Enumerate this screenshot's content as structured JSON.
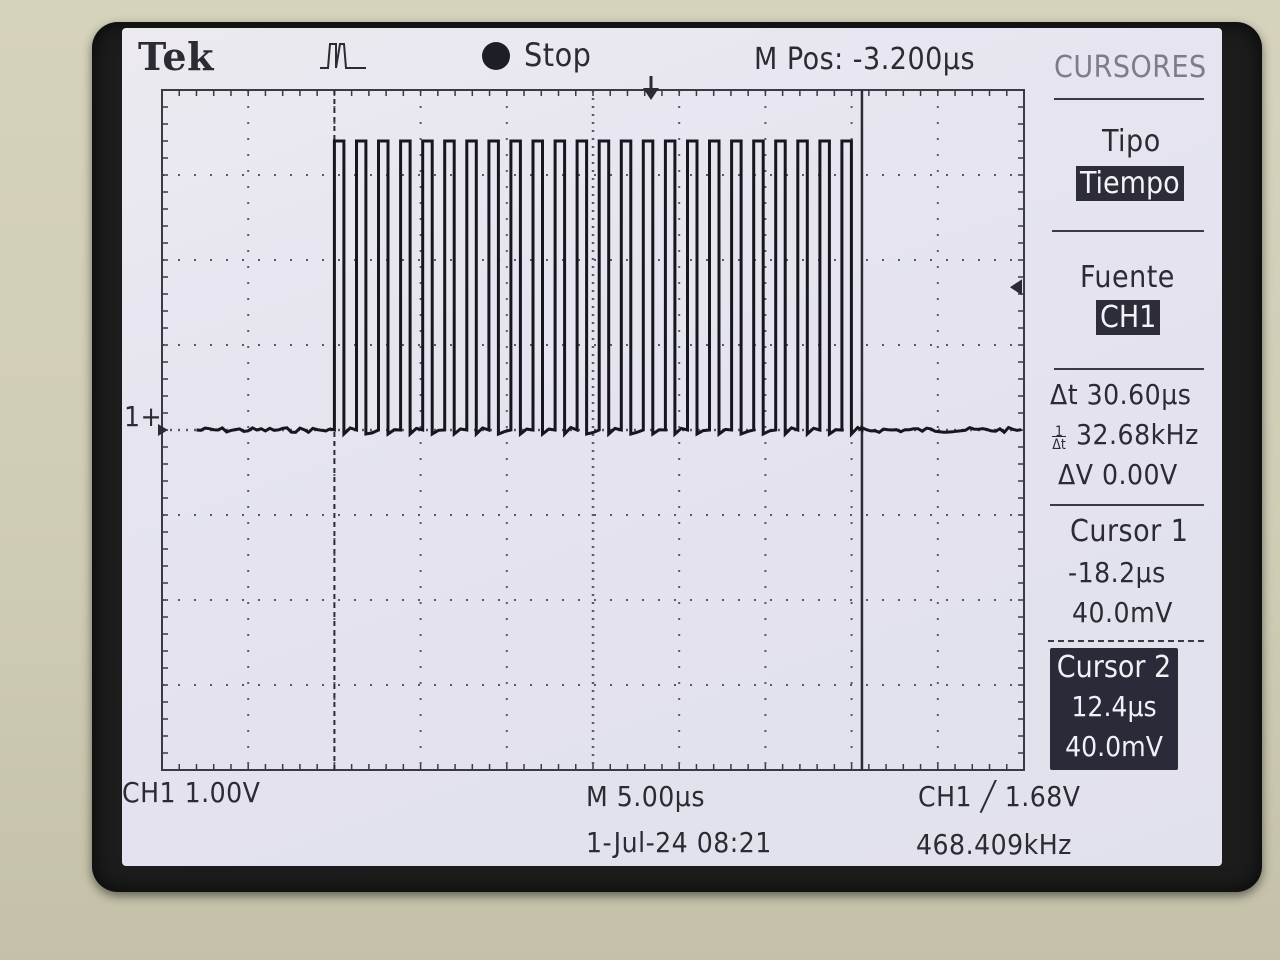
{
  "header": {
    "brand": "Tek",
    "trigger_state": "Stop",
    "position": "M Pos: -3.200µs",
    "menu_title": "CURSORES"
  },
  "side_menu": {
    "type_label": "Tipo",
    "type_value": "Tiempo",
    "source_label": "Fuente",
    "source_value": "CH1",
    "delta_t": "Δt 30.60µs",
    "inv_delta_t": "32.68kHz",
    "delta_v": "ΔV 0.00V",
    "cursor1": {
      "title": "Cursor 1",
      "time": "-18.2µs",
      "volt": "40.0mV"
    },
    "cursor2": {
      "title": "Cursor 2",
      "time": "12.4µs",
      "volt": "40.0mV"
    }
  },
  "footer": {
    "ch1_scale": "CH1  1.00V",
    "timebase": "M 5.00µs",
    "trigger_info": "CH1 ╱ 1.68V",
    "date": "1-Jul-24 08:21",
    "frequency": "468.409kHz"
  },
  "markers": {
    "ch1_ground": "1+"
  },
  "chart_data": {
    "type": "line",
    "title": "",
    "xlabel": "",
    "ylabel": "",
    "time_per_div_us": 5.0,
    "volts_per_div": 1.0,
    "x_range_us": [
      -28.2,
      21.8
    ],
    "y_range_v": [
      -4.0,
      4.0
    ],
    "baseline_v": 0.0,
    "pulse_high_v": 3.4,
    "series": [
      {
        "name": "CH1",
        "burst_start_us": -18.2,
        "burst_end_us": 12.4,
        "pulse_count": 24,
        "pulse_period_us": 1.28,
        "pulse_width_us": 0.55
      }
    ],
    "cursors_us": [
      -18.2,
      12.4
    ],
    "grid": true
  }
}
